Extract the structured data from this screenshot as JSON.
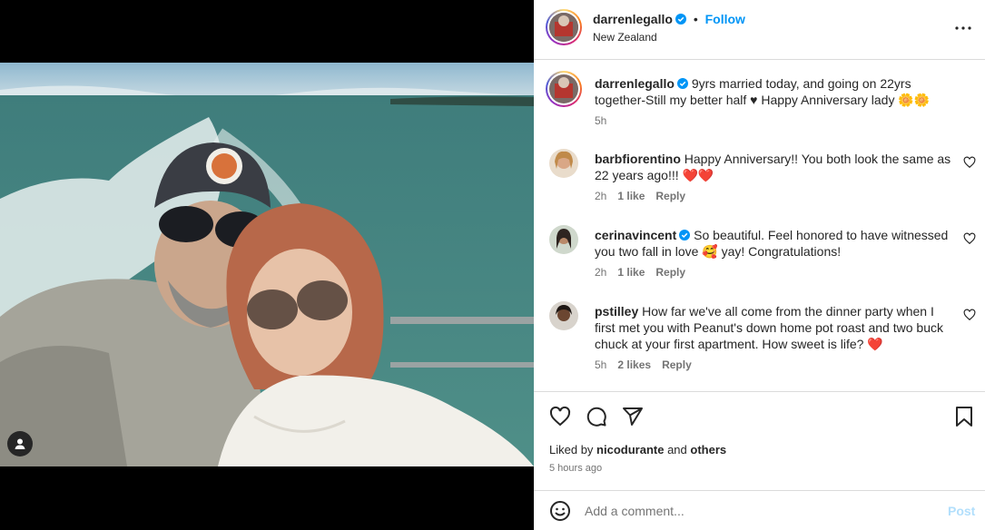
{
  "post": {
    "username": "darrenlegallo",
    "follow_label": "Follow",
    "location": "New Zealand",
    "dot": "•"
  },
  "caption": {
    "username": "darrenlegallo",
    "text": "9yrs married today, and going on 22yrs together-Still my better half ♥ Happy Anniversary lady 🌼🌼",
    "time": "5h"
  },
  "comments": [
    {
      "username": "barbfiorentino",
      "text": "Happy Anniversary!! You both look the same as 22 years ago!!! ❤️❤️",
      "time": "2h",
      "likes": "1 like",
      "reply": "Reply",
      "verified": false
    },
    {
      "username": "cerinavincent",
      "text": "So beautiful. Feel honored to have witnessed you two fall in love 🥰 yay! Congratulations!",
      "time": "2h",
      "likes": "1 like",
      "reply": "Reply",
      "verified": true
    },
    {
      "username": "pstilley",
      "text": "How far we've all come from the dinner party when I first met you with Peanut's down home pot roast and two buck chuck at your first apartment. How sweet is life? ❤️",
      "time": "5h",
      "likes": "2 likes",
      "reply": "Reply",
      "verified": false
    }
  ],
  "likes": {
    "prefix": "Liked by",
    "user": "nicodurante",
    "and": "and",
    "others": "others"
  },
  "timestamp": "5 hours ago",
  "composer": {
    "placeholder": "Add a comment...",
    "post_label": "Post"
  },
  "colors": {
    "accent": "#0095f6",
    "heart_red": "#e0245e"
  }
}
